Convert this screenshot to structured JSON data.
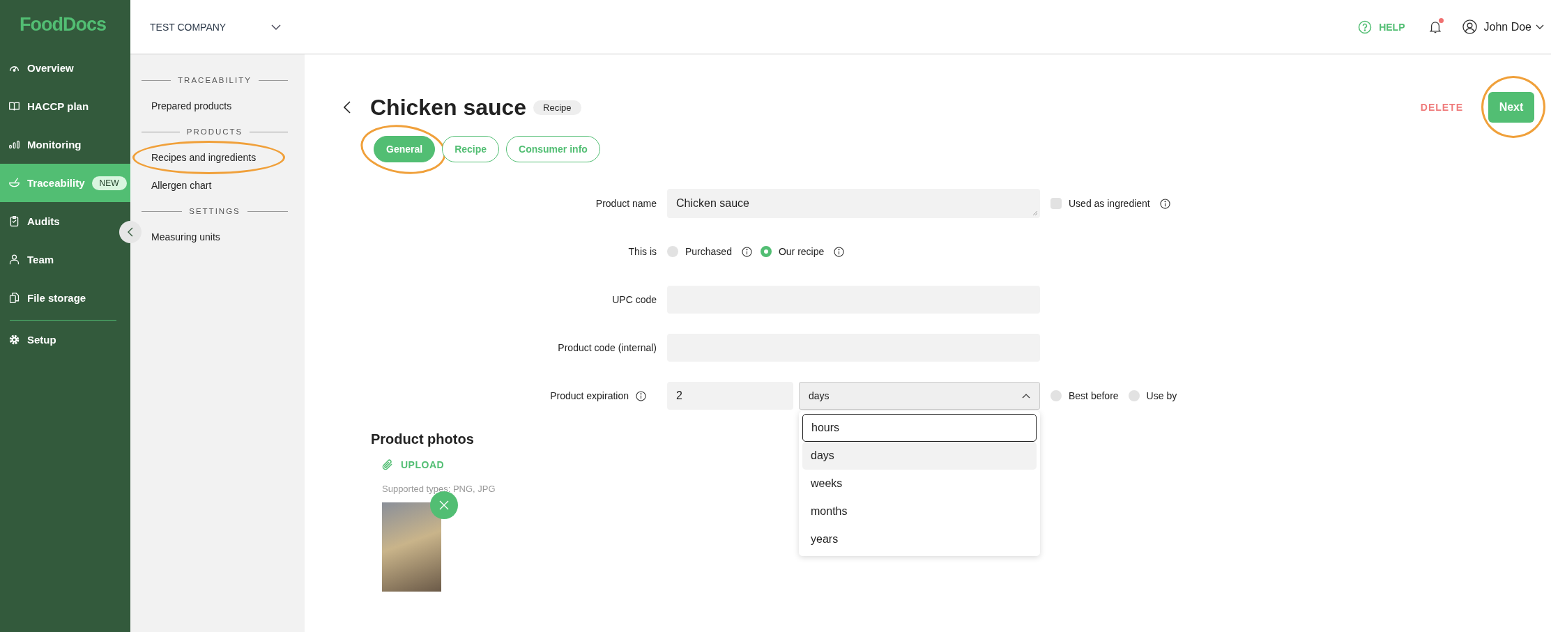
{
  "logo": "FoodDocs",
  "nav": [
    {
      "label": "Overview",
      "selected": false
    },
    {
      "label": "HACCP plan",
      "selected": false
    },
    {
      "label": "Monitoring",
      "selected": false
    },
    {
      "label": "Traceability",
      "selected": true,
      "badge": "NEW"
    },
    {
      "label": "Audits",
      "selected": false
    },
    {
      "label": "Team",
      "selected": false
    },
    {
      "label": "File storage",
      "selected": false
    }
  ],
  "nav_bottom": [
    {
      "label": "Setup",
      "selected": false
    }
  ],
  "company": "TEST COMPANY",
  "topbar": {
    "help": "HELP",
    "has_notification": true,
    "user": "John Doe"
  },
  "subnav": [
    {
      "kind": "heading",
      "label": "TRACEABILITY"
    },
    {
      "kind": "link",
      "label": "Prepared products",
      "circled": false
    },
    {
      "kind": "heading",
      "label": "PRODUCTS"
    },
    {
      "kind": "link",
      "label": "Recipes and ingredients",
      "circled": true
    },
    {
      "kind": "link",
      "label": "Allergen chart",
      "circled": false
    },
    {
      "kind": "heading",
      "label": "SETTINGS"
    },
    {
      "kind": "link",
      "label": "Measuring units",
      "circled": false
    }
  ],
  "page": {
    "title": "Chicken sauce",
    "badge": "Recipe",
    "delete": "DELETE",
    "next": "Next",
    "next_circled": true
  },
  "tabs": [
    {
      "label": "General",
      "selected": true,
      "circled": true
    },
    {
      "label": "Recipe",
      "selected": false,
      "circled": false
    },
    {
      "label": "Consumer info",
      "selected": false,
      "circled": false
    }
  ],
  "form": {
    "product_name": {
      "label": "Product name",
      "value": "Chicken sauce"
    },
    "used_as_ingredient": {
      "label": "Used as ingredient",
      "checked": false
    },
    "this_is": {
      "label": "This is",
      "options": [
        {
          "label": "Purchased",
          "selected": false
        },
        {
          "label": "Our recipe",
          "selected": true
        }
      ]
    },
    "upc_code": {
      "label": "UPC code"
    },
    "product_code": {
      "label": "Product code (internal)"
    },
    "expiration": {
      "label": "Product expiration",
      "value": "2",
      "unit": "days",
      "options": [
        {
          "label": "hours",
          "selected": false,
          "focused": true
        },
        {
          "label": "days",
          "selected": true,
          "focused": false
        },
        {
          "label": "weeks",
          "selected": false,
          "focused": false
        },
        {
          "label": "months",
          "selected": false,
          "focused": false
        },
        {
          "label": "years",
          "selected": false,
          "focused": false
        }
      ],
      "best_before": {
        "label": "Best before",
        "checked": false
      },
      "use_by": {
        "label": "Use by",
        "checked": false
      }
    }
  },
  "photos": {
    "title": "Product photos",
    "upload": "UPLOAD",
    "supported": "Supported types: PNG, JPG"
  }
}
